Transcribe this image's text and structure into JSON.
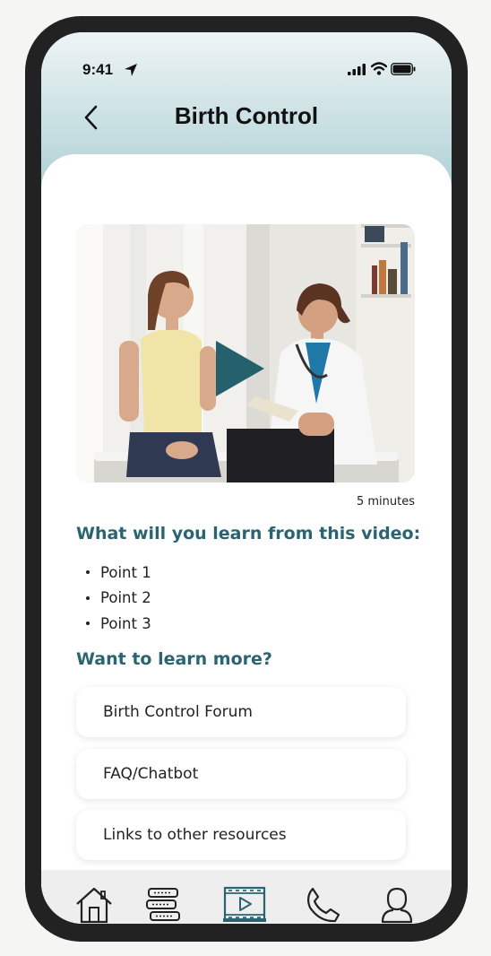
{
  "status_bar": {
    "time": "9:41"
  },
  "header": {
    "title": "Birth Control"
  },
  "video": {
    "duration": "5 minutes"
  },
  "learn": {
    "heading": "What will you learn from this video:",
    "points": [
      "Point 1",
      "Point 2",
      "Point 3"
    ]
  },
  "more": {
    "heading": "Want to learn more?",
    "links": [
      "Birth Control Forum",
      "FAQ/Chatbot",
      "Links to other resources"
    ]
  },
  "tabbar": {
    "tabs": [
      "home-icon",
      "list-icon",
      "video-icon",
      "phone-icon",
      "profile-icon"
    ],
    "active": "video-icon"
  },
  "colors": {
    "accent": "#2a6470",
    "header_gradient_top": "#eef4f5",
    "header_gradient_bottom": "#a6ccd1"
  }
}
